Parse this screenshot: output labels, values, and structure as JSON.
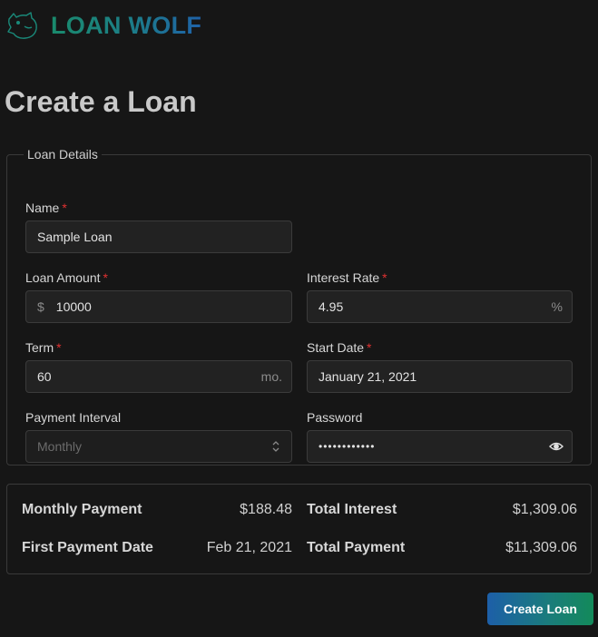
{
  "brand": {
    "name": "LOAN WOLF"
  },
  "page": {
    "title": "Create a Loan"
  },
  "details": {
    "legend": "Loan Details",
    "name": {
      "label": "Name",
      "value": "Sample Loan"
    },
    "loan_amount": {
      "label": "Loan Amount",
      "prefix": "$",
      "value": "10000"
    },
    "interest_rate": {
      "label": "Interest Rate",
      "value": "4.95",
      "suffix": "%"
    },
    "term": {
      "label": "Term",
      "value": "60",
      "suffix": "mo."
    },
    "start_date": {
      "label": "Start Date",
      "value": "January 21, 2021"
    },
    "payment_interval": {
      "label": "Payment Interval",
      "value": "Monthly"
    },
    "password": {
      "label": "Password",
      "value": "••••••••••••"
    }
  },
  "summary": {
    "monthly_payment": {
      "label": "Monthly Payment",
      "value": "$188.48"
    },
    "first_payment_date": {
      "label": "First Payment Date",
      "value": "Feb 21, 2021"
    },
    "total_interest": {
      "label": "Total Interest",
      "value": "$1,309.06"
    },
    "total_payment": {
      "label": "Total Payment",
      "value": "$11,309.06"
    }
  },
  "actions": {
    "create_label": "Create Loan"
  },
  "colors": {
    "background": "#161616",
    "required": "#e03131",
    "brand_start": "#1a8a6c",
    "brand_end": "#1f62a8"
  }
}
